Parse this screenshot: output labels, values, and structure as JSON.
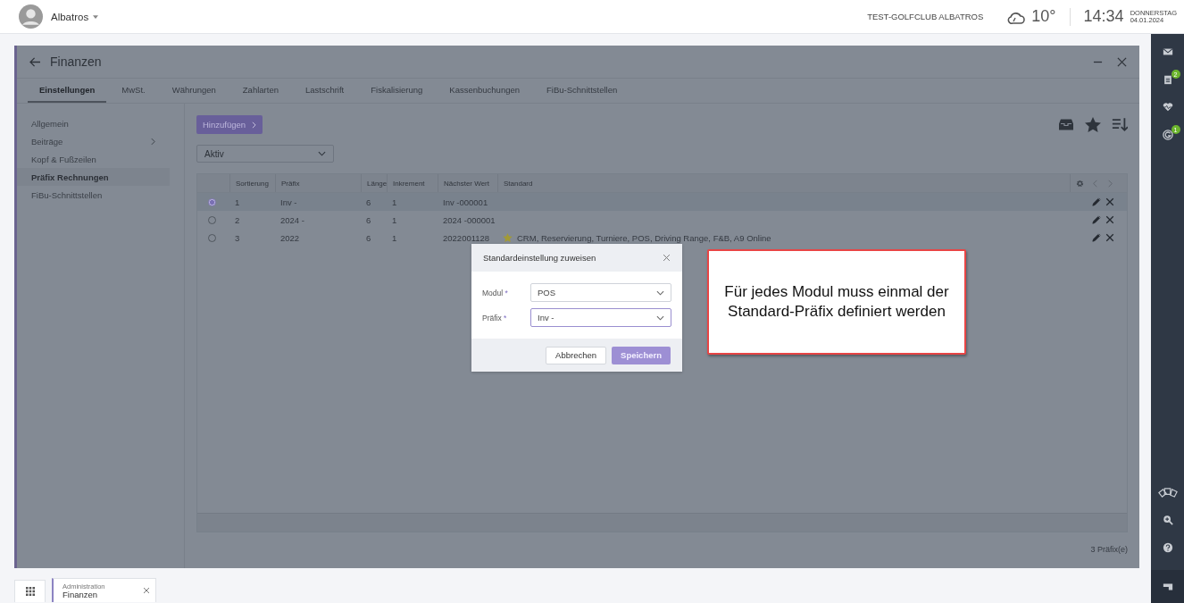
{
  "header": {
    "user": "Albatros",
    "club": "TEST-GOLFCLUB ALBATROS",
    "temperature": "10°",
    "time": "14:34",
    "weekday": "DONNERSTAG",
    "date": "04.01.2024"
  },
  "window": {
    "title": "Finanzen"
  },
  "tabs": [
    {
      "label": "Einstellungen",
      "selected": true
    },
    {
      "label": "MwSt.",
      "selected": false
    },
    {
      "label": "Währungen",
      "selected": false
    },
    {
      "label": "Zahlarten",
      "selected": false
    },
    {
      "label": "Lastschrift",
      "selected": false
    },
    {
      "label": "Fiskalisierung",
      "selected": false
    },
    {
      "label": "Kassenbuchungen",
      "selected": false
    },
    {
      "label": "FiBu-Schnittstellen",
      "selected": false
    }
  ],
  "sidebar": {
    "items": [
      {
        "label": "Allgemein",
        "selected": false,
        "has_submenu": false
      },
      {
        "label": "Beiträge",
        "selected": false,
        "has_submenu": true
      },
      {
        "label": "Kopf & Fußzeilen",
        "selected": false,
        "has_submenu": false
      },
      {
        "label": "Präfix Rechnungen",
        "selected": true,
        "has_submenu": false
      },
      {
        "label": "FiBu-Schnittstellen",
        "selected": false,
        "has_submenu": false
      }
    ]
  },
  "add_button": "Hinzufügen",
  "filter": {
    "value": "Aktiv"
  },
  "table": {
    "columns": [
      "Sortierung",
      "Präfix",
      "Länge",
      "Inkrement",
      "Nächster Wert",
      "Standard"
    ],
    "rows": [
      {
        "selected": true,
        "cells": [
          "1",
          "Inv -",
          "6",
          "1",
          "Inv -000001"
        ],
        "starred": false
      },
      {
        "selected": false,
        "cells": [
          "2",
          "2024 -",
          "6",
          "1",
          "2024 -000001"
        ],
        "starred": false
      },
      {
        "selected": false,
        "cells": [
          "3",
          "2022",
          "6",
          "1",
          "2022001128"
        ],
        "starred": true,
        "standard": "CRM, Reservierung, Turniere, POS, Driving Range, F&B, A9 Online"
      }
    ]
  },
  "footer": {
    "count": "3 Präfix(e)"
  },
  "dialog": {
    "title": "Standardeinstellung zuweisen",
    "fields": [
      {
        "label": "Modul",
        "mark": "*",
        "value": "POS",
        "focused": false
      },
      {
        "label": "Präfix",
        "mark": "*",
        "value": "Inv -",
        "focused": true
      }
    ],
    "buttons": [
      {
        "label": "Abbrechen",
        "kind": "secondary"
      },
      {
        "label": "Speichern",
        "kind": "primary"
      }
    ]
  },
  "callout": {
    "text": "Für jedes Modul muss einmal der Standard-Präfix definiert werden"
  },
  "rail": {
    "top": [
      {
        "kind": "mail"
      },
      {
        "kind": "clipboard",
        "badge": "2"
      },
      {
        "kind": "heart"
      },
      {
        "kind": "g",
        "badge": "1"
      }
    ],
    "bottom": [
      {
        "kind": "cards"
      },
      {
        "kind": "zoom"
      },
      {
        "kind": "help"
      }
    ]
  },
  "taskbar": {
    "tabs": [
      {
        "category": "Administration",
        "title": "Finanzen"
      }
    ]
  }
}
